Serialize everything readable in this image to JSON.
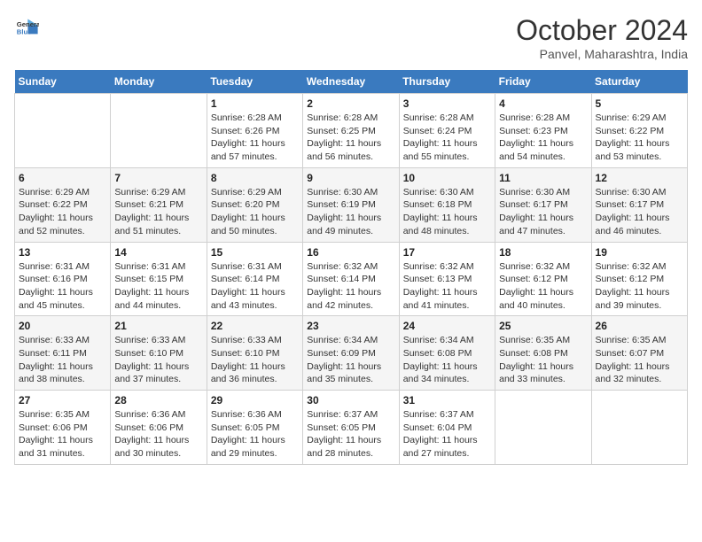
{
  "header": {
    "logo_line1": "General",
    "logo_line2": "Blue",
    "month_title": "October 2024",
    "location": "Panvel, Maharashtra, India"
  },
  "weekdays": [
    "Sunday",
    "Monday",
    "Tuesday",
    "Wednesday",
    "Thursday",
    "Friday",
    "Saturday"
  ],
  "weeks": [
    [
      {
        "day": "",
        "sunrise": "",
        "sunset": "",
        "daylight": ""
      },
      {
        "day": "",
        "sunrise": "",
        "sunset": "",
        "daylight": ""
      },
      {
        "day": "1",
        "sunrise": "Sunrise: 6:28 AM",
        "sunset": "Sunset: 6:26 PM",
        "daylight": "Daylight: 11 hours and 57 minutes."
      },
      {
        "day": "2",
        "sunrise": "Sunrise: 6:28 AM",
        "sunset": "Sunset: 6:25 PM",
        "daylight": "Daylight: 11 hours and 56 minutes."
      },
      {
        "day": "3",
        "sunrise": "Sunrise: 6:28 AM",
        "sunset": "Sunset: 6:24 PM",
        "daylight": "Daylight: 11 hours and 55 minutes."
      },
      {
        "day": "4",
        "sunrise": "Sunrise: 6:28 AM",
        "sunset": "Sunset: 6:23 PM",
        "daylight": "Daylight: 11 hours and 54 minutes."
      },
      {
        "day": "5",
        "sunrise": "Sunrise: 6:29 AM",
        "sunset": "Sunset: 6:22 PM",
        "daylight": "Daylight: 11 hours and 53 minutes."
      }
    ],
    [
      {
        "day": "6",
        "sunrise": "Sunrise: 6:29 AM",
        "sunset": "Sunset: 6:22 PM",
        "daylight": "Daylight: 11 hours and 52 minutes."
      },
      {
        "day": "7",
        "sunrise": "Sunrise: 6:29 AM",
        "sunset": "Sunset: 6:21 PM",
        "daylight": "Daylight: 11 hours and 51 minutes."
      },
      {
        "day": "8",
        "sunrise": "Sunrise: 6:29 AM",
        "sunset": "Sunset: 6:20 PM",
        "daylight": "Daylight: 11 hours and 50 minutes."
      },
      {
        "day": "9",
        "sunrise": "Sunrise: 6:30 AM",
        "sunset": "Sunset: 6:19 PM",
        "daylight": "Daylight: 11 hours and 49 minutes."
      },
      {
        "day": "10",
        "sunrise": "Sunrise: 6:30 AM",
        "sunset": "Sunset: 6:18 PM",
        "daylight": "Daylight: 11 hours and 48 minutes."
      },
      {
        "day": "11",
        "sunrise": "Sunrise: 6:30 AM",
        "sunset": "Sunset: 6:17 PM",
        "daylight": "Daylight: 11 hours and 47 minutes."
      },
      {
        "day": "12",
        "sunrise": "Sunrise: 6:30 AM",
        "sunset": "Sunset: 6:17 PM",
        "daylight": "Daylight: 11 hours and 46 minutes."
      }
    ],
    [
      {
        "day": "13",
        "sunrise": "Sunrise: 6:31 AM",
        "sunset": "Sunset: 6:16 PM",
        "daylight": "Daylight: 11 hours and 45 minutes."
      },
      {
        "day": "14",
        "sunrise": "Sunrise: 6:31 AM",
        "sunset": "Sunset: 6:15 PM",
        "daylight": "Daylight: 11 hours and 44 minutes."
      },
      {
        "day": "15",
        "sunrise": "Sunrise: 6:31 AM",
        "sunset": "Sunset: 6:14 PM",
        "daylight": "Daylight: 11 hours and 43 minutes."
      },
      {
        "day": "16",
        "sunrise": "Sunrise: 6:32 AM",
        "sunset": "Sunset: 6:14 PM",
        "daylight": "Daylight: 11 hours and 42 minutes."
      },
      {
        "day": "17",
        "sunrise": "Sunrise: 6:32 AM",
        "sunset": "Sunset: 6:13 PM",
        "daylight": "Daylight: 11 hours and 41 minutes."
      },
      {
        "day": "18",
        "sunrise": "Sunrise: 6:32 AM",
        "sunset": "Sunset: 6:12 PM",
        "daylight": "Daylight: 11 hours and 40 minutes."
      },
      {
        "day": "19",
        "sunrise": "Sunrise: 6:32 AM",
        "sunset": "Sunset: 6:12 PM",
        "daylight": "Daylight: 11 hours and 39 minutes."
      }
    ],
    [
      {
        "day": "20",
        "sunrise": "Sunrise: 6:33 AM",
        "sunset": "Sunset: 6:11 PM",
        "daylight": "Daylight: 11 hours and 38 minutes."
      },
      {
        "day": "21",
        "sunrise": "Sunrise: 6:33 AM",
        "sunset": "Sunset: 6:10 PM",
        "daylight": "Daylight: 11 hours and 37 minutes."
      },
      {
        "day": "22",
        "sunrise": "Sunrise: 6:33 AM",
        "sunset": "Sunset: 6:10 PM",
        "daylight": "Daylight: 11 hours and 36 minutes."
      },
      {
        "day": "23",
        "sunrise": "Sunrise: 6:34 AM",
        "sunset": "Sunset: 6:09 PM",
        "daylight": "Daylight: 11 hours and 35 minutes."
      },
      {
        "day": "24",
        "sunrise": "Sunrise: 6:34 AM",
        "sunset": "Sunset: 6:08 PM",
        "daylight": "Daylight: 11 hours and 34 minutes."
      },
      {
        "day": "25",
        "sunrise": "Sunrise: 6:35 AM",
        "sunset": "Sunset: 6:08 PM",
        "daylight": "Daylight: 11 hours and 33 minutes."
      },
      {
        "day": "26",
        "sunrise": "Sunrise: 6:35 AM",
        "sunset": "Sunset: 6:07 PM",
        "daylight": "Daylight: 11 hours and 32 minutes."
      }
    ],
    [
      {
        "day": "27",
        "sunrise": "Sunrise: 6:35 AM",
        "sunset": "Sunset: 6:06 PM",
        "daylight": "Daylight: 11 hours and 31 minutes."
      },
      {
        "day": "28",
        "sunrise": "Sunrise: 6:36 AM",
        "sunset": "Sunset: 6:06 PM",
        "daylight": "Daylight: 11 hours and 30 minutes."
      },
      {
        "day": "29",
        "sunrise": "Sunrise: 6:36 AM",
        "sunset": "Sunset: 6:05 PM",
        "daylight": "Daylight: 11 hours and 29 minutes."
      },
      {
        "day": "30",
        "sunrise": "Sunrise: 6:37 AM",
        "sunset": "Sunset: 6:05 PM",
        "daylight": "Daylight: 11 hours and 28 minutes."
      },
      {
        "day": "31",
        "sunrise": "Sunrise: 6:37 AM",
        "sunset": "Sunset: 6:04 PM",
        "daylight": "Daylight: 11 hours and 27 minutes."
      },
      {
        "day": "",
        "sunrise": "",
        "sunset": "",
        "daylight": ""
      },
      {
        "day": "",
        "sunrise": "",
        "sunset": "",
        "daylight": ""
      }
    ]
  ]
}
